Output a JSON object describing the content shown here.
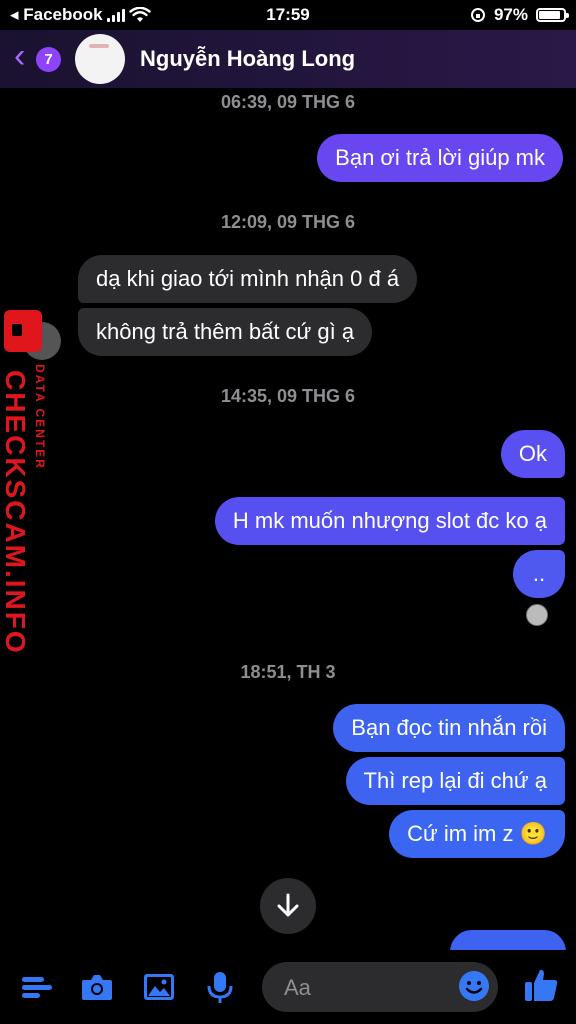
{
  "status_bar": {
    "carrier": "◂ Facebook",
    "time": "17:59",
    "battery_percent": "97%",
    "battery_level": 0.97
  },
  "header": {
    "back_count": "7",
    "contact_name": "Nguyễn Hoàng Long"
  },
  "messages": [
    {
      "type": "timestamp",
      "text": "06:39, 09 THG 6"
    },
    {
      "type": "out",
      "text": "Bạn ơi trả lời giúp mk"
    },
    {
      "type": "timestamp",
      "text": "12:09, 09 THG 6"
    },
    {
      "type": "in",
      "text": "dạ khi giao tới mình nhận 0 đ á"
    },
    {
      "type": "in",
      "text": "không trả thêm bất cứ gì ạ"
    },
    {
      "type": "timestamp",
      "text": "14:35, 09 THG 6"
    },
    {
      "type": "out",
      "text": "Ok"
    },
    {
      "type": "out",
      "text": "H mk muốn nhượng slot đc ko ạ"
    },
    {
      "type": "out",
      "text": ".."
    },
    {
      "type": "timestamp",
      "text": "18:51, TH 3"
    },
    {
      "type": "out",
      "text": "Bạn đọc tin nhắn rồi"
    },
    {
      "type": "out",
      "text": "Thì rep lại đi chứ ạ"
    },
    {
      "type": "out",
      "text": "Cứ im im z 🙂"
    }
  ],
  "watermark": {
    "main": "CHECKSCAM.INFO",
    "sub": "DATA CENTER"
  },
  "composer": {
    "placeholder": "Aa"
  },
  "icons": {
    "menu": "menu-icon",
    "camera": "camera-icon",
    "gallery": "image-icon",
    "mic": "microphone-icon",
    "emoji": "emoji-icon",
    "like": "thumbs-up-icon",
    "scroll": "arrow-down-icon"
  },
  "colors": {
    "accent_purple": "#6846f0",
    "accent_blue": "#3d63f0",
    "incoming_bubble": "#2c2c2e",
    "watermark_red": "#e0161d"
  }
}
